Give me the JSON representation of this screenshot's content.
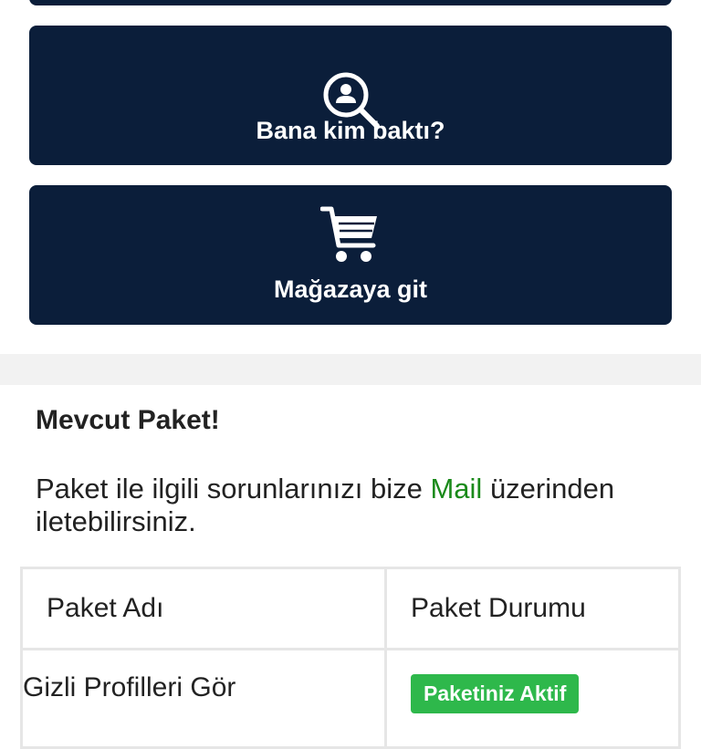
{
  "actions": {
    "who_viewed": {
      "label": "Bana kim baktı?",
      "icon": "profile-search-icon"
    },
    "store": {
      "label": "Mağazaya git",
      "icon": "shopping-cart-icon"
    }
  },
  "package": {
    "title": "Mevcut Paket!",
    "desc_prefix": "Paket ile ilgili sorunlarınızı bize ",
    "mail_link": "Mail",
    "desc_suffix": " üzerinden iletebilirsiniz.",
    "table": {
      "headers": [
        "Paket Adı",
        "Paket Durumu"
      ],
      "rows": [
        {
          "name": "Gizli Profilleri Gör",
          "status": "Paketiniz Aktif"
        }
      ]
    }
  },
  "colors": {
    "card_bg": "#0b1e3a",
    "link_green": "#1a8a1a",
    "badge_green": "#2eb84b"
  }
}
